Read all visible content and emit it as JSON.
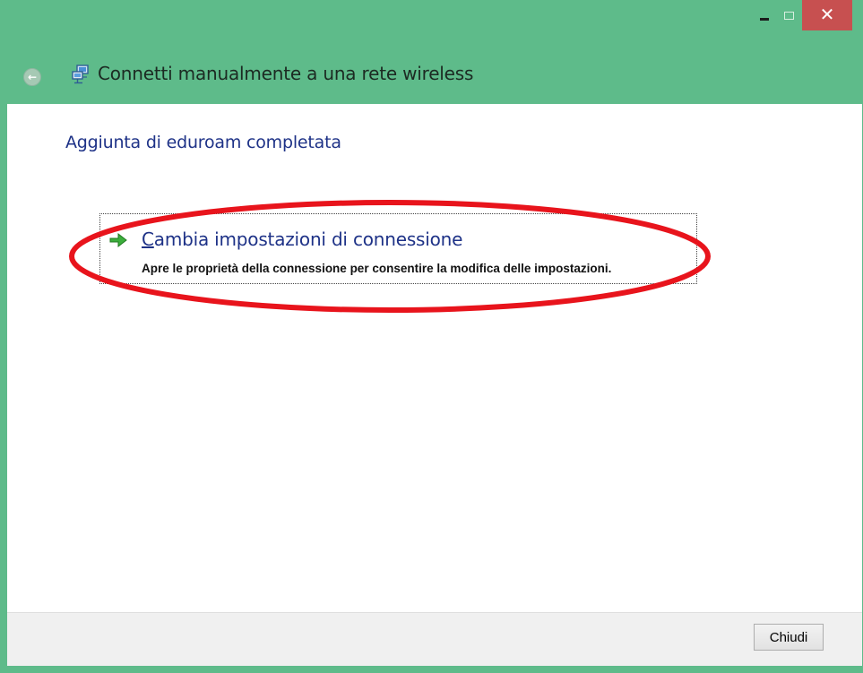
{
  "window": {
    "title": "Connetti manualmente a una rete wireless",
    "frame_color": "#5ebb8a",
    "close_color": "#c75050"
  },
  "caption_buttons": {
    "minimize_icon": "minimize-icon",
    "maximize_icon": "maximize-icon",
    "close_glyph": "✕"
  },
  "content": {
    "heading": "Aggiunta di eduroam completata",
    "heading_color": "#1e3287"
  },
  "option": {
    "icon": "green-arrow-icon",
    "title_accelerator": "C",
    "title_rest": "ambia impostazioni di connessione",
    "description": "Apre le proprietà della connessione per consentire la modifica delle impostazioni."
  },
  "annotation": {
    "shape": "ellipse",
    "color": "#e8141c"
  },
  "footer": {
    "close_label": "Chiudi"
  }
}
